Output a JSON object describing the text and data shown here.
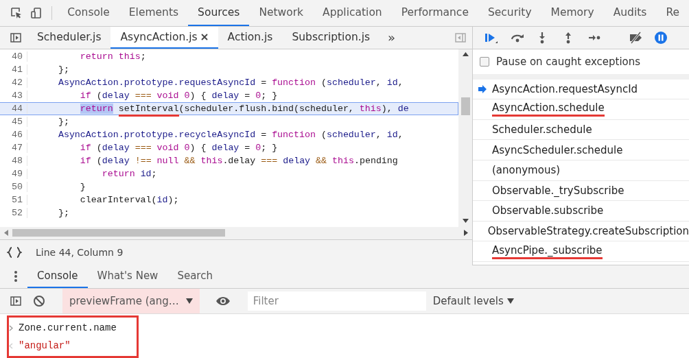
{
  "main_tabs": [
    {
      "label": "Console",
      "selected": false
    },
    {
      "label": "Elements",
      "selected": false
    },
    {
      "label": "Sources",
      "selected": true
    },
    {
      "label": "Network",
      "selected": false
    },
    {
      "label": "Application",
      "selected": false
    },
    {
      "label": "Performance",
      "selected": false
    },
    {
      "label": "Security",
      "selected": false
    },
    {
      "label": "Memory",
      "selected": false
    },
    {
      "label": "Audits",
      "selected": false
    },
    {
      "label": "Re",
      "selected": false
    }
  ],
  "file_tabs": [
    {
      "label": "Scheduler.js",
      "selected": false,
      "closable": false
    },
    {
      "label": "AsyncAction.js",
      "selected": true,
      "closable": true
    },
    {
      "label": "Action.js",
      "selected": false,
      "closable": false
    },
    {
      "label": "Subscription.js",
      "selected": false,
      "closable": false
    }
  ],
  "file_tabs_overflow": "»",
  "editor": {
    "lines": [
      {
        "number": "40",
        "highlighted": false,
        "tokens": [
          {
            "text": "        return ",
            "kind": "kw"
          },
          {
            "text": "this",
            "kind": "kw"
          },
          {
            "text": ";",
            "kind": "plain"
          }
        ]
      },
      {
        "number": "41",
        "highlighted": false,
        "tokens": [
          {
            "text": "    };",
            "kind": "plain"
          }
        ]
      },
      {
        "number": "42",
        "highlighted": false,
        "tokens": [
          {
            "text": "    AsyncAction.prototype.requestAsyncId",
            "kind": "name"
          },
          {
            "text": " = ",
            "kind": "plain"
          },
          {
            "text": "function",
            "kind": "kw"
          },
          {
            "text": " (",
            "kind": "plain"
          },
          {
            "text": "scheduler",
            "kind": "name"
          },
          {
            "text": ", ",
            "kind": "plain"
          },
          {
            "text": "id",
            "kind": "name"
          },
          {
            "text": ",",
            "kind": "plain"
          }
        ]
      },
      {
        "number": "43",
        "highlighted": false,
        "tokens": [
          {
            "text": "        if",
            "kind": "kw"
          },
          {
            "text": " (",
            "kind": "plain"
          },
          {
            "text": "delay ",
            "kind": "name"
          },
          {
            "text": "=== ",
            "kind": "op"
          },
          {
            "text": "void 0",
            "kind": "kw"
          },
          {
            "text": ") { ",
            "kind": "plain"
          },
          {
            "text": "delay",
            "kind": "name"
          },
          {
            "text": " = ",
            "kind": "plain"
          },
          {
            "text": "0",
            "kind": "kw"
          },
          {
            "text": "; }",
            "kind": "plain"
          }
        ]
      },
      {
        "number": "44",
        "highlighted": true,
        "tokens": [
          {
            "text": "        return",
            "kind": "kw",
            "selected": true
          },
          {
            "text": " setInterval",
            "kind": "plain",
            "marked": true
          },
          {
            "text": "(scheduler.flush.bind(scheduler, ",
            "kind": "plain"
          },
          {
            "text": "this",
            "kind": "kw"
          },
          {
            "text": "), ",
            "kind": "plain"
          },
          {
            "text": "de",
            "kind": "name"
          }
        ]
      },
      {
        "number": "45",
        "highlighted": false,
        "tokens": [
          {
            "text": "    };",
            "kind": "plain"
          }
        ]
      },
      {
        "number": "46",
        "highlighted": false,
        "tokens": [
          {
            "text": "    AsyncAction.prototype.recycleAsyncId",
            "kind": "name"
          },
          {
            "text": " = ",
            "kind": "plain"
          },
          {
            "text": "function",
            "kind": "kw"
          },
          {
            "text": " (",
            "kind": "plain"
          },
          {
            "text": "scheduler",
            "kind": "name"
          },
          {
            "text": ", ",
            "kind": "plain"
          },
          {
            "text": "id",
            "kind": "name"
          },
          {
            "text": ",",
            "kind": "plain"
          }
        ]
      },
      {
        "number": "47",
        "highlighted": false,
        "tokens": [
          {
            "text": "        if",
            "kind": "kw"
          },
          {
            "text": " (",
            "kind": "plain"
          },
          {
            "text": "delay ",
            "kind": "name"
          },
          {
            "text": "=== ",
            "kind": "op"
          },
          {
            "text": "void 0",
            "kind": "kw"
          },
          {
            "text": ") { ",
            "kind": "plain"
          },
          {
            "text": "delay",
            "kind": "name"
          },
          {
            "text": " = ",
            "kind": "plain"
          },
          {
            "text": "0",
            "kind": "kw"
          },
          {
            "text": "; }",
            "kind": "plain"
          }
        ]
      },
      {
        "number": "48",
        "highlighted": false,
        "tokens": [
          {
            "text": "        if",
            "kind": "kw"
          },
          {
            "text": " (",
            "kind": "plain"
          },
          {
            "text": "delay ",
            "kind": "name"
          },
          {
            "text": "!== ",
            "kind": "op"
          },
          {
            "text": "null ",
            "kind": "kw"
          },
          {
            "text": "&& ",
            "kind": "op"
          },
          {
            "text": "this",
            "kind": "kw"
          },
          {
            "text": ".delay ",
            "kind": "plain"
          },
          {
            "text": "=== ",
            "kind": "op"
          },
          {
            "text": "delay ",
            "kind": "name"
          },
          {
            "text": "&& ",
            "kind": "op"
          },
          {
            "text": "this",
            "kind": "kw"
          },
          {
            "text": ".pending",
            "kind": "plain"
          }
        ]
      },
      {
        "number": "49",
        "highlighted": false,
        "tokens": [
          {
            "text": "            return ",
            "kind": "kw"
          },
          {
            "text": "id",
            "kind": "name"
          },
          {
            "text": ";",
            "kind": "plain"
          }
        ]
      },
      {
        "number": "50",
        "highlighted": false,
        "tokens": [
          {
            "text": "        }",
            "kind": "plain"
          }
        ]
      },
      {
        "number": "51",
        "highlighted": false,
        "tokens": [
          {
            "text": "        clearInterval(",
            "kind": "plain"
          },
          {
            "text": "id",
            "kind": "name"
          },
          {
            "text": ");",
            "kind": "plain"
          }
        ]
      },
      {
        "number": "52",
        "highlighted": false,
        "tokens": [
          {
            "text": "    };",
            "kind": "plain"
          }
        ]
      }
    ]
  },
  "status": {
    "position": "Line 44, Column 9"
  },
  "pause_on_caught": {
    "label": "Pause on caught exceptions",
    "checked": false
  },
  "call_stack": [
    {
      "label": "AsyncAction.requestAsyncId",
      "current": true,
      "marked": false
    },
    {
      "label": "AsyncAction.schedule",
      "current": false,
      "marked": true
    },
    {
      "label": "Scheduler.schedule",
      "current": false,
      "marked": false
    },
    {
      "label": "AsyncScheduler.schedule",
      "current": false,
      "marked": false
    },
    {
      "label": "(anonymous)",
      "current": false,
      "marked": false
    },
    {
      "label": "Observable._trySubscribe",
      "current": false,
      "marked": false
    },
    {
      "label": "Observable.subscribe",
      "current": false,
      "marked": false
    },
    {
      "label": "ObservableStrategy.createSubscription",
      "current": false,
      "marked": false
    },
    {
      "label": "AsyncPipe._subscribe",
      "current": false,
      "marked": true
    }
  ],
  "drawer_tabs": [
    {
      "label": "Console",
      "selected": true
    },
    {
      "label": "What's New",
      "selected": false
    },
    {
      "label": "Search",
      "selected": false
    }
  ],
  "console_toolbar": {
    "context": "previewFrame (ang…",
    "filter_placeholder": "Filter",
    "levels": "Default levels"
  },
  "console_output": {
    "boxed": true,
    "entries": [
      {
        "kind": "input",
        "text": "Zone.current.name"
      },
      {
        "kind": "result",
        "text": "\"angular\""
      }
    ]
  }
}
